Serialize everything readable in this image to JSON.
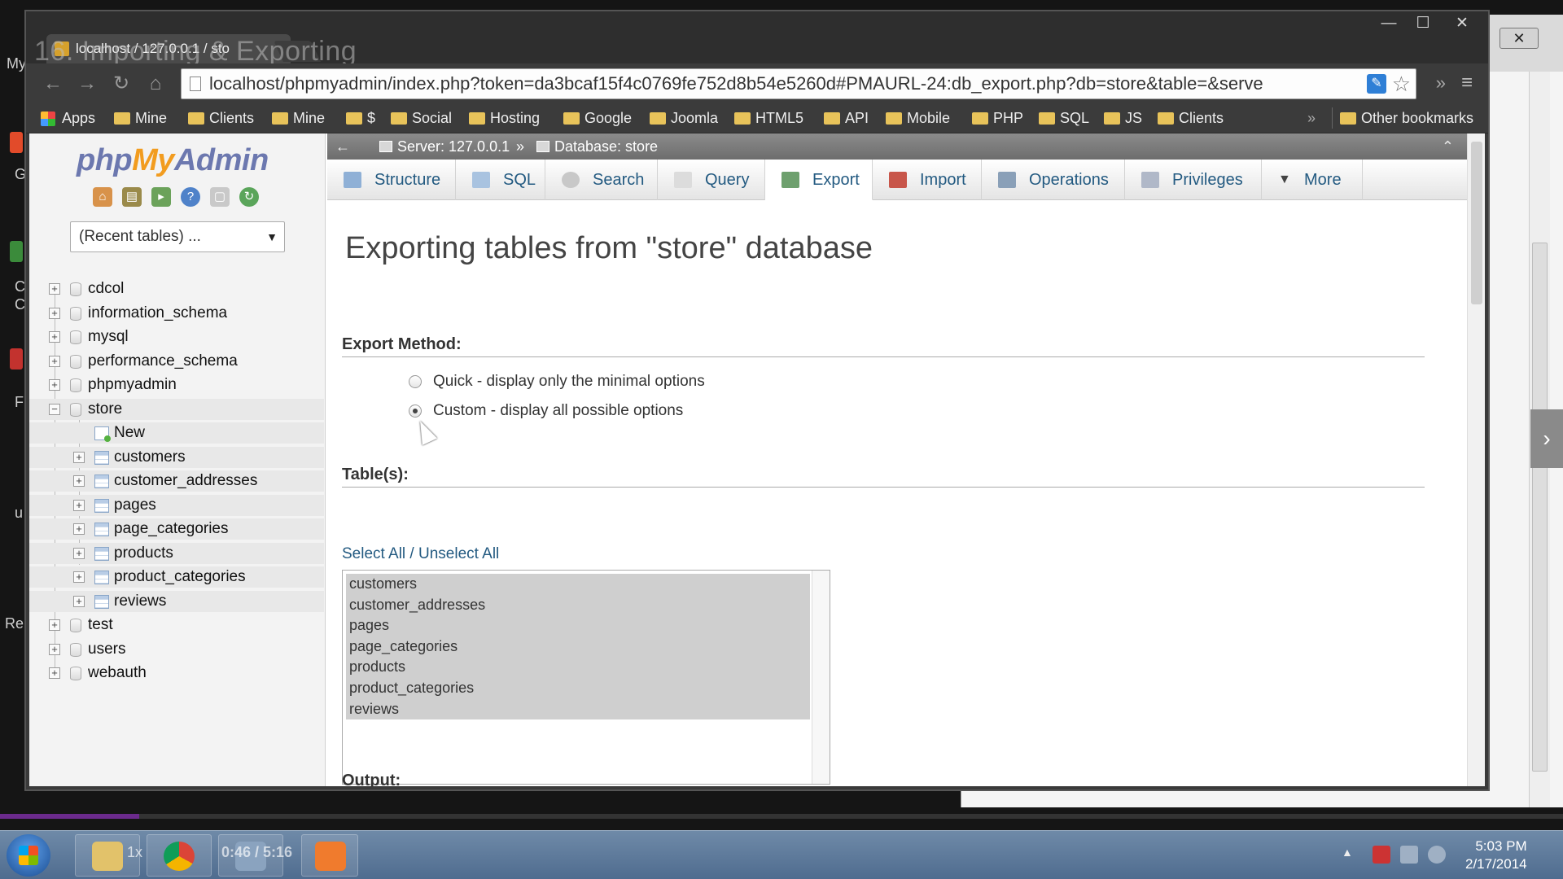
{
  "video": {
    "title_overlay": "16. Importing & Exporting",
    "speed": "1x",
    "time": "0:46 / 5:16",
    "progress_fraction": 0.089
  },
  "background": {
    "left_labels": [
      "My",
      "G",
      "C",
      "C",
      "F",
      "u",
      "Re"
    ],
    "close_glyph": "✕",
    "side_arrow": "›"
  },
  "browser": {
    "tab_title": "localhost / 127.0.0.1 / sto",
    "window_controls": {
      "minimize": "—",
      "maximize": "☐",
      "close": "✕"
    },
    "nav": {
      "back": "←",
      "forward": "→",
      "reload": "↻",
      "home": "⌂"
    },
    "url": "localhost/phpmyadmin/index.php?token=da3bcaf15f4c0769fe752d8b54e5260d#PMAURL-24:db_export.php?db=store&table=&serve",
    "overflow_glyph": "»",
    "menu_glyph": "≡",
    "bookmarks": [
      "Apps",
      "Mine",
      "Clients",
      "Mine",
      "$",
      "Social",
      "Hosting",
      "Google",
      "Joomla",
      "HTML5",
      "API",
      "Mobile",
      "PHP",
      "SQL",
      "JS",
      "Clients"
    ],
    "bookmarks_overflow": "»",
    "other_bookmarks": "Other bookmarks"
  },
  "pma": {
    "logo": {
      "php": "php",
      "my": "My",
      "admin": "Admin"
    },
    "recent_tables": "(Recent tables) ...",
    "recent_arrow": "▼",
    "databases": [
      {
        "name": "cdcol",
        "expander": "+"
      },
      {
        "name": "information_schema",
        "expander": "+"
      },
      {
        "name": "mysql",
        "expander": "+"
      },
      {
        "name": "performance_schema",
        "expander": "+"
      },
      {
        "name": "phpmyadmin",
        "expander": "+"
      },
      {
        "name": "store",
        "expander": "−"
      },
      {
        "name": "test",
        "expander": "+"
      },
      {
        "name": "users",
        "expander": "+"
      },
      {
        "name": "webauth",
        "expander": "+"
      }
    ],
    "store_children": [
      {
        "name": "New",
        "expander": ""
      },
      {
        "name": "customers",
        "expander": "+"
      },
      {
        "name": "customer_addresses",
        "expander": "+"
      },
      {
        "name": "pages",
        "expander": "+"
      },
      {
        "name": "page_categories",
        "expander": "+"
      },
      {
        "name": "products",
        "expander": "+"
      },
      {
        "name": "product_categories",
        "expander": "+"
      },
      {
        "name": "reviews",
        "expander": "+"
      }
    ],
    "breadcrumb": {
      "collapse": "←",
      "server": "Server: 127.0.0.1",
      "separator": "»",
      "database": "Database: store",
      "up": "⌃"
    },
    "tabs": [
      "Structure",
      "SQL",
      "Search",
      "Query",
      "Export",
      "Import",
      "Operations",
      "Privileges",
      "More"
    ],
    "active_tab": "Export",
    "heading": "Exporting tables from \"store\" database",
    "export_method_label": "Export Method:",
    "export_methods": [
      {
        "label": "Quick - display only the minimal options",
        "checked": false
      },
      {
        "label": "Custom - display all possible options",
        "checked": true
      }
    ],
    "tables_label": "Table(s):",
    "select_all": "Select All / Unselect All",
    "tables": [
      "customers",
      "customer_addresses",
      "pages",
      "page_categories",
      "products",
      "product_categories",
      "reviews"
    ],
    "output_label": "Output:"
  },
  "taskbar": {
    "clock_time": "5:03 PM",
    "clock_date": "2/17/2014",
    "tray_up": "▲"
  }
}
